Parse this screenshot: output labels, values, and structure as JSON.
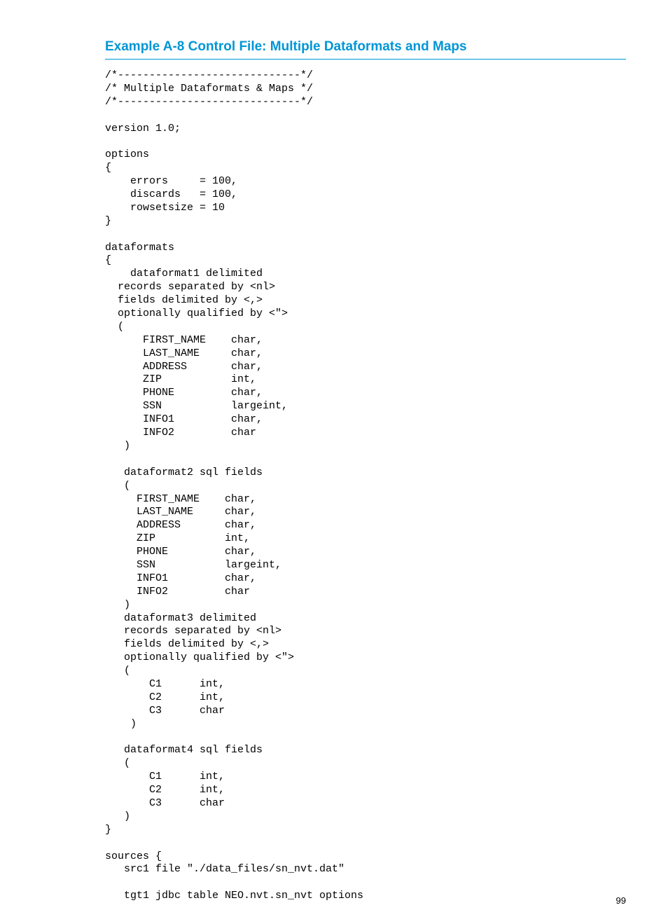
{
  "heading": "Example A-8 Control File: Multiple Dataformats and Maps",
  "code": "/*-----------------------------*/\n/* Multiple Dataformats & Maps */\n/*-----------------------------*/\n\nversion 1.0;\n\noptions\n{\n    errors     = 100,\n    discards   = 100,\n    rowsetsize = 10\n}\n\ndataformats\n{\n    dataformat1 delimited\n  records separated by <nl>\n  fields delimited by <,>\n  optionally qualified by <\">\n  (\n      FIRST_NAME    char,\n      LAST_NAME     char,\n      ADDRESS       char,\n      ZIP           int,\n      PHONE         char,\n      SSN           largeint,\n      INFO1         char,\n      INFO2         char\n   )\n\n   dataformat2 sql fields\n   (\n     FIRST_NAME    char,\n     LAST_NAME     char,\n     ADDRESS       char,\n     ZIP           int,\n     PHONE         char,\n     SSN           largeint,\n     INFO1         char,\n     INFO2         char\n   )\n   dataformat3 delimited\n   records separated by <nl>\n   fields delimited by <,>\n   optionally qualified by <\">\n   (\n       C1      int,\n       C2      int,\n       C3      char\n    )\n\n   dataformat4 sql fields\n   (\n       C1      int,\n       C2      int,\n       C3      char\n   )\n}\n\nsources {\n   src1 file \"./data_files/sn_nvt.dat\"\n\n   tgt1 jdbc table NEO.nvt.sn_nvt options",
  "page_number": "99"
}
